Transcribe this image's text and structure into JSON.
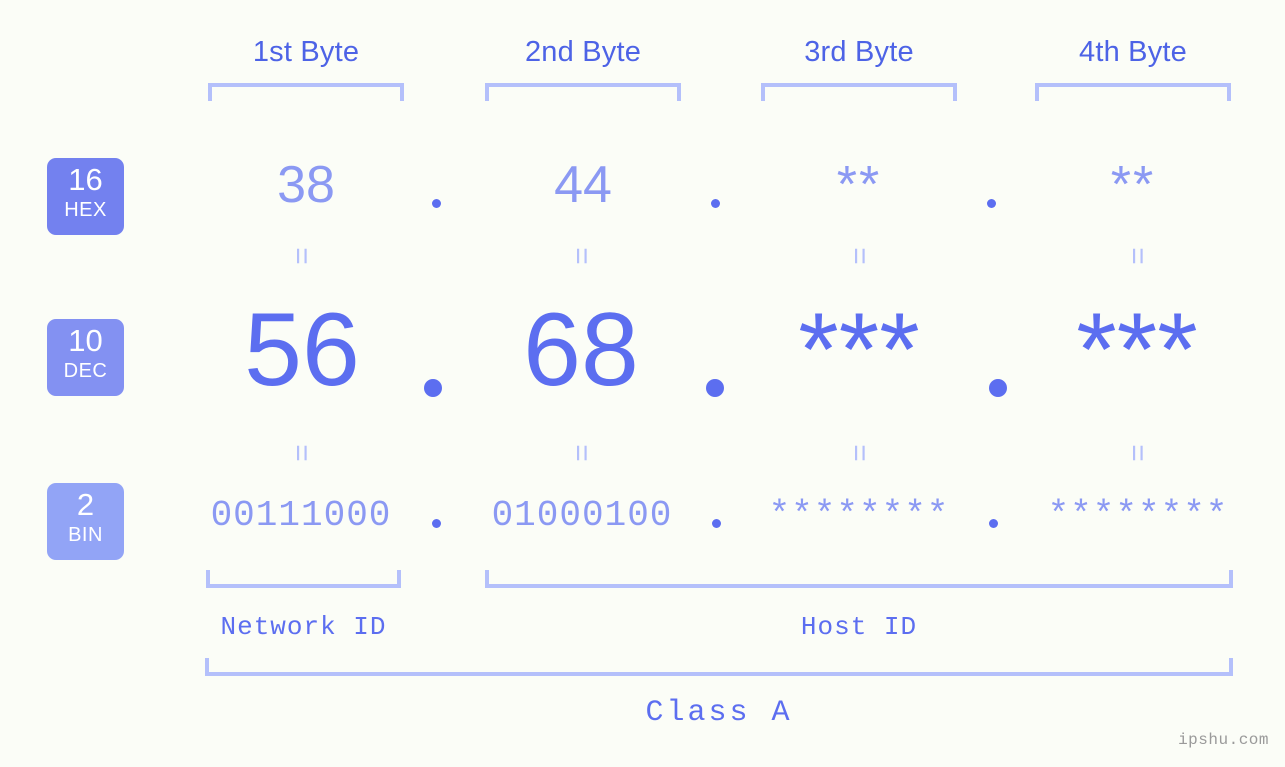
{
  "background_color": "#fbfdf7",
  "accent_color": "#5c6ef0",
  "accent_light": "#8b99f3",
  "bracket_color": "#b4c0fb",
  "byte_headers": [
    {
      "label": "1st Byte"
    },
    {
      "label": "2nd Byte"
    },
    {
      "label": "3rd Byte"
    },
    {
      "label": "4th Byte"
    }
  ],
  "bases": [
    {
      "num": "16",
      "name": "HEX",
      "color": "#7381ef"
    },
    {
      "num": "10",
      "name": "DEC",
      "color": "#8391f2"
    },
    {
      "num": "2",
      "name": "BIN",
      "color": "#92a4f6"
    }
  ],
  "rows": {
    "hex": {
      "base": "16",
      "base_name": "HEX",
      "values": [
        "38",
        "44",
        "**",
        "**"
      ]
    },
    "dec": {
      "base": "10",
      "base_name": "DEC",
      "values": [
        "56",
        "68",
        "***",
        "***"
      ]
    },
    "bin": {
      "base": "2",
      "base_name": "BIN",
      "values": [
        "00111000",
        "01000100",
        "********",
        "********"
      ]
    }
  },
  "separator": ".",
  "equals_sign": "=",
  "segments": [
    {
      "label": "Network ID"
    },
    {
      "label": "Host ID"
    }
  ],
  "class_label": "Class A",
  "watermark": "ipshu.com"
}
